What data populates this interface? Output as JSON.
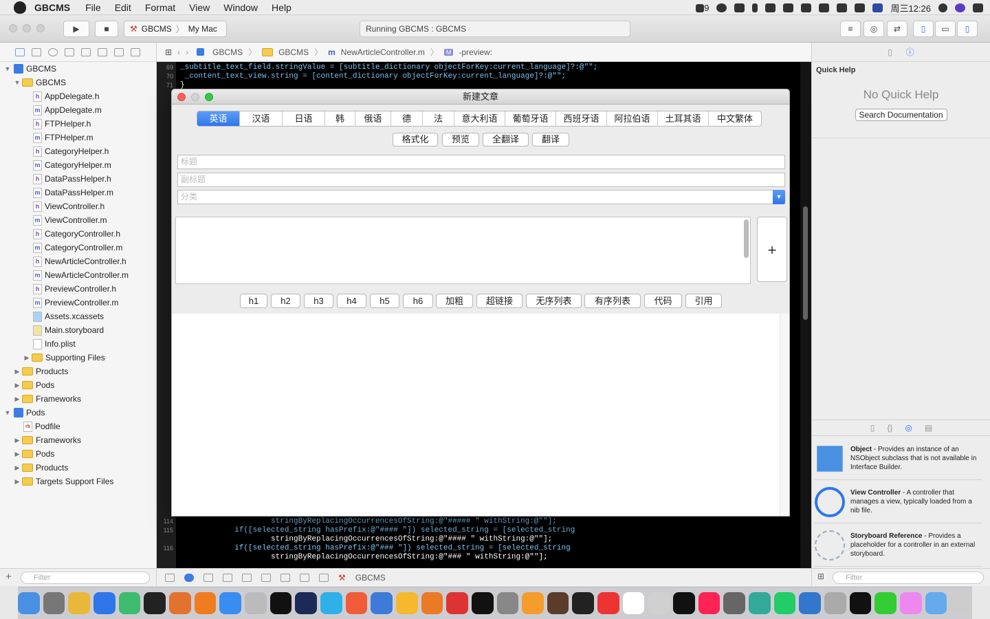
{
  "menubar": {
    "app_name": "GBCMS",
    "items": [
      "File",
      "Edit",
      "Format",
      "View",
      "Window",
      "Help"
    ],
    "status": {
      "battery_text": "9",
      "clock": "周三12:26"
    }
  },
  "toolbar": {
    "scheme_target": "GBCMS",
    "scheme_device": "My Mac",
    "activity_text": "Running GBCMS : GBCMS"
  },
  "navigator": {
    "filter_placeholder": "Filter",
    "tree": [
      {
        "label": "GBCMS",
        "kind": "project",
        "indent": 0,
        "expanded": true
      },
      {
        "label": "GBCMS",
        "kind": "folder",
        "indent": 1,
        "expanded": true
      },
      {
        "label": "AppDelegate.h",
        "kind": "h",
        "indent": 2
      },
      {
        "label": "AppDelegate.m",
        "kind": "m",
        "indent": 2
      },
      {
        "label": "FTPHelper.h",
        "kind": "h",
        "indent": 2
      },
      {
        "label": "FTPHelper.m",
        "kind": "m",
        "indent": 2
      },
      {
        "label": "CategoryHelper.h",
        "kind": "h",
        "indent": 2
      },
      {
        "label": "CategoryHelper.m",
        "kind": "m",
        "indent": 2
      },
      {
        "label": "DataPassHelper.h",
        "kind": "h",
        "indent": 2
      },
      {
        "label": "DataPassHelper.m",
        "kind": "m",
        "indent": 2
      },
      {
        "label": "ViewController.h",
        "kind": "h",
        "indent": 2
      },
      {
        "label": "ViewController.m",
        "kind": "m",
        "indent": 2
      },
      {
        "label": "CategoryController.h",
        "kind": "h",
        "indent": 2
      },
      {
        "label": "CategoryController.m",
        "kind": "m",
        "indent": 2
      },
      {
        "label": "NewArticleController.h",
        "kind": "h",
        "indent": 2
      },
      {
        "label": "NewArticleController.m",
        "kind": "m",
        "indent": 2
      },
      {
        "label": "PreviewController.h",
        "kind": "h",
        "indent": 2
      },
      {
        "label": "PreviewController.m",
        "kind": "m",
        "indent": 2
      },
      {
        "label": "Assets.xcassets",
        "kind": "assets",
        "indent": 2
      },
      {
        "label": "Main.storyboard",
        "kind": "storyboard",
        "indent": 2
      },
      {
        "label": "Info.plist",
        "kind": "plist",
        "indent": 2
      },
      {
        "label": "Supporting Files",
        "kind": "folder",
        "indent": 2,
        "expanded": false
      },
      {
        "label": "Products",
        "kind": "folder",
        "indent": 1,
        "expanded": false
      },
      {
        "label": "Pods",
        "kind": "folder",
        "indent": 1,
        "expanded": false
      },
      {
        "label": "Frameworks",
        "kind": "folder",
        "indent": 1,
        "expanded": false
      },
      {
        "label": "Pods",
        "kind": "project",
        "indent": 0,
        "expanded": true
      },
      {
        "label": "Podfile",
        "kind": "rb",
        "indent": 1
      },
      {
        "label": "Frameworks",
        "kind": "folder",
        "indent": 1,
        "expanded": false
      },
      {
        "label": "Pods",
        "kind": "folder",
        "indent": 1,
        "expanded": false
      },
      {
        "label": "Products",
        "kind": "folder",
        "indent": 1,
        "expanded": false
      },
      {
        "label": "Targets Support Files",
        "kind": "folder",
        "indent": 1,
        "expanded": false
      }
    ]
  },
  "jumpbar": {
    "crumbs": [
      "GBCMS",
      "GBCMS",
      "NewArticleController.m",
      "-preview:"
    ]
  },
  "editor": {
    "top_lines": [
      {
        "num": "69",
        "text": "_subtitle_text_field.stringValue = [subtitle_dictionary objectForKey:current_language]?:@\"\";"
      },
      {
        "num": "70",
        "text": " _content_text_view.string = [content_dictionary objectForKey:current_language]?:@\"\";"
      },
      {
        "num": "71",
        "text": "}"
      }
    ],
    "bottom_lines": [
      {
        "num": "114",
        "text": "                    stringByReplacingOccurrencesOfString:@\"##### \" withString:@\"\"];"
      },
      {
        "num": "115",
        "text": "            if([selected_string hasPrefix:@\"#### \"]) selected_string = [selected_string"
      },
      {
        "num": "",
        "text": "                    stringByReplacingOccurrencesOfString:@\"#### \" withString:@\"\"];"
      },
      {
        "num": "116",
        "text": "            if([selected_string hasPrefix:@\"### \"]) selected_string = [selected_string"
      },
      {
        "num": "",
        "text": "                    stringByReplacingOccurrencesOfString:@\"### \" withString:@\"\"];"
      }
    ]
  },
  "debugbar": {
    "target": "GBCMS"
  },
  "utilities": {
    "quick_help_title": "Quick Help",
    "no_quick_help": "No Quick Help",
    "search_doc_label": "Search Documentation",
    "library_filter_placeholder": "Filter",
    "library": [
      {
        "name": "Object",
        "desc": " - Provides an instance of an NSObject subclass that is not available in Interface Builder."
      },
      {
        "name": "View Controller",
        "desc": " - A controller that manages a view, typically loaded from a nib file."
      },
      {
        "name": "Storyboard Reference",
        "desc": " - Provides a placeholder for a controller in an external storyboard."
      }
    ]
  },
  "dialog": {
    "title": "新建文章",
    "languages": [
      "英语",
      "汉语",
      "日语",
      "韩语",
      "俄语",
      "德语",
      "法语",
      "意大利语",
      "葡萄牙语",
      "西班牙语",
      "阿拉伯语",
      "土耳其语",
      "中文繁体"
    ],
    "selected_language": "英语",
    "actions": [
      "格式化",
      "预览",
      "全翻译",
      "翻译"
    ],
    "title_placeholder": "标题",
    "subtitle_placeholder": "副标题",
    "category_placeholder": "分类",
    "plus_label": "+",
    "markdown_buttons": [
      "h1",
      "h2",
      "h3",
      "h4",
      "h5",
      "h6",
      "加粗",
      "超链接",
      "无序列表",
      "有序列表",
      "代码",
      "引用"
    ]
  },
  "colors": {
    "accent": "#2f76ea",
    "editor_bg": "#000000"
  }
}
